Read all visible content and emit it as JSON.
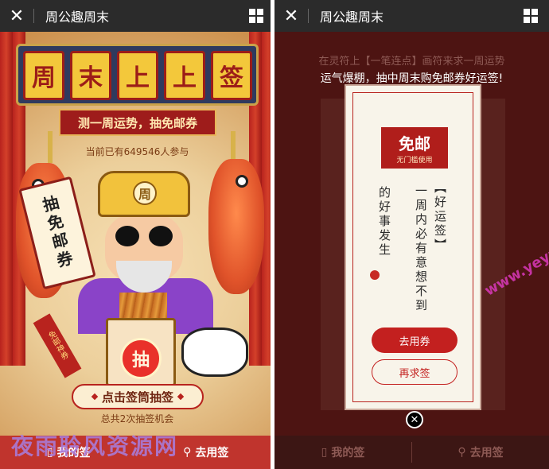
{
  "left_screen": {
    "navbar": {
      "close_icon": "close-icon",
      "title": "周公趣周末",
      "menu_icon": "grid-icon"
    },
    "banner": {
      "chars": [
        "周",
        "末",
        "上",
        "上",
        "签"
      ]
    },
    "subtitle": "测一周运势，抽免邮券",
    "participants": "当前已有649546人参与",
    "scroll_text": "抽免邮券",
    "hat_char": "周",
    "tube_char": "抽",
    "ticket_text": "免邮神券",
    "draw_button": "点击签筒抽签",
    "chances": "总共2次抽签机会",
    "bottom_bar": {
      "my_signs": "我的签",
      "use_sign": "去用签"
    },
    "watermark": "夜雨聆风资源网",
    "colors": {
      "accent": "#b8231e",
      "banner_blue": "#2f3a5e",
      "gold": "#f2c23c"
    }
  },
  "right_screen": {
    "navbar": {
      "close_icon": "close-icon",
      "title": "周公趣周末",
      "menu_icon": "grid-icon"
    },
    "overlay_line1": "在灵符上【一笔连点】画符来求一周运势",
    "overlay_line2": "运气爆棚，抽中周末购免邮券好运签!",
    "stamp": {
      "main": "免邮",
      "sub": "无门槛使用"
    },
    "verse_lines": [
      "【好运签】",
      "一周内必有意想不到",
      "的好事发生"
    ],
    "buttons": {
      "use_coupon": "去用券",
      "draw_again": "再求签"
    },
    "close_icon": "close-icon",
    "bottom_bar": {
      "my_signs": "我的签",
      "use_sign": "去用签"
    },
    "watermark_url": "www.yeyulingfeng.com",
    "colors": {
      "overlay": "#4d1412",
      "button_red": "#c3201f"
    }
  }
}
